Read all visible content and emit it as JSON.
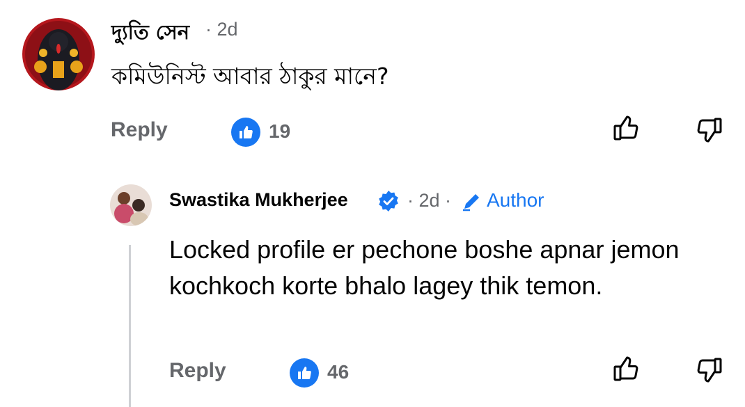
{
  "comment": {
    "author": "দ্যুতি সেন",
    "time": "· 2d",
    "text": "কমিউনিস্ট আবার ঠাকুর মানে?",
    "reply_label": "Reply",
    "reaction_count": "19"
  },
  "reply": {
    "author": "Swastika Mukherjee",
    "time": "· 2d ·",
    "author_badge": "Author",
    "text": "Locked profile er pechone boshe apnar jemon kochkoch korte bhalo lagey thik temon.",
    "reply_label": "Reply",
    "reaction_count": "46"
  },
  "icons": {
    "like": "thumbs-up-icon",
    "dislike": "thumbs-down-icon",
    "verified": "verified-badge-icon",
    "edit": "pencil-icon"
  },
  "colors": {
    "accent": "#1877f2",
    "muted": "#65676b",
    "thread": "#ced0d4"
  }
}
